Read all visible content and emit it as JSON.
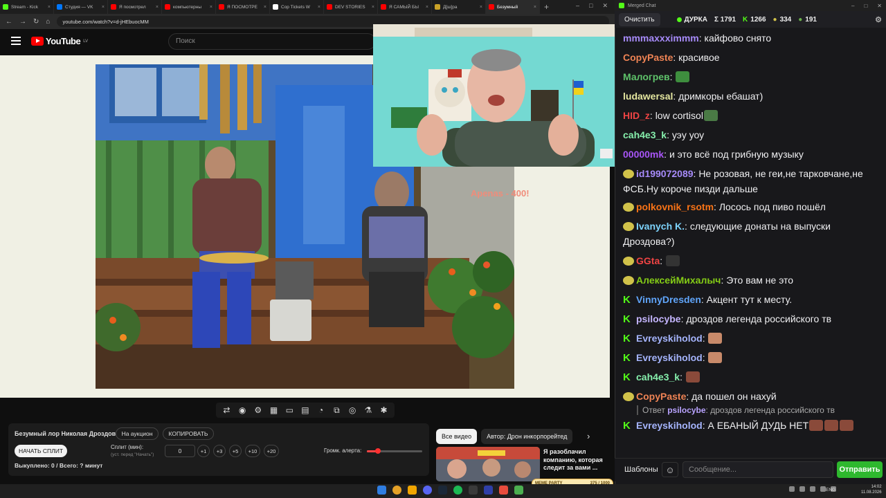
{
  "browser": {
    "tabs": [
      {
        "label": "Stream - Kick",
        "color": "#53fc18",
        "active": false
      },
      {
        "label": "Студия — VK",
        "color": "#0077ff",
        "active": false
      },
      {
        "label": "Я посмотрел",
        "color": "#ff0000",
        "active": false
      },
      {
        "label": "компьютерны",
        "color": "#ff0000",
        "active": false
      },
      {
        "label": "Я ПОСМОТРЕ",
        "color": "#ff0000",
        "active": false
      },
      {
        "label": "Cop Tickets W",
        "color": "#ffffff",
        "active": false
      },
      {
        "label": "DEV STORIES",
        "color": "#ff0000",
        "active": false
      },
      {
        "label": "Я САМЫЙ БЫ",
        "color": "#ff0000",
        "active": false
      },
      {
        "label": "Д[ш]ра",
        "color": "#c9a227",
        "active": false
      },
      {
        "label": "Безумный",
        "color": "#ff0000",
        "active": true
      }
    ],
    "new_tab": "+",
    "url": "youtube.com/watch?v=d-jHEbuocMM"
  },
  "youtube": {
    "logo_text": "YouTube",
    "region": "LV",
    "search_placeholder": "Поиск",
    "donation_alert": "Apenas - 400!",
    "split": {
      "title": "Безумный лор Николая Дроздова",
      "auction_btn": "На аукцион",
      "copy_btn": "КОПИРОВАТЬ",
      "start_btn": "НАЧАТЬ СПЛИТ",
      "split_label": "Сплит (мин):",
      "split_hint": "(уст. перед \"Начать\")",
      "split_value": "0",
      "increments": [
        "+1",
        "+3",
        "+5",
        "+10",
        "+20"
      ],
      "volume_label": "Громк. алерта:",
      "volume_level": 0.2,
      "bought": "Выкуплено: 0 / Всего: ? минут"
    },
    "chips": [
      "Все видео",
      "Автор: Дрон инкорпорейтед"
    ],
    "rec_title": "Я разоблачил компанию, которая следит за вами ...",
    "meme_party": "MEME PARTY",
    "meme_count": "375 / 1000"
  },
  "taskbar": {
    "lang": "ENG",
    "time": "14:02",
    "date": "11.08.2026"
  },
  "chat": {
    "window_title": "Merged Chat",
    "clear_btn": "Очистить",
    "channel": "ДУРКА",
    "stats": [
      "Σ 1791",
      "1266",
      "334",
      "191"
    ],
    "messages": [
      {
        "user": "mmmaxxximmm",
        "color": "#a78bfa",
        "text": "кайфово снято",
        "badge": "none"
      },
      {
        "user": "CopyPaste",
        "color": "#ef8354",
        "text": "красивое",
        "badge": "none"
      },
      {
        "user": "Малогрев",
        "color": "#5ec26a",
        "text": "",
        "badge": "none",
        "emote": "#3e8e3e"
      },
      {
        "user": "ludawersal",
        "color": "#e5e7a0",
        "text": "дримкоры ебашат)",
        "badge": "none"
      },
      {
        "user": "HID_z",
        "color": "#ef4444",
        "text": "low cortisol",
        "badge": "none",
        "emote": "#4a7a45"
      },
      {
        "user": "cah4e3_k",
        "color": "#86efac",
        "text": "уэу уоу",
        "badge": "none"
      },
      {
        "user": "00000mk",
        "color": "#a855f7",
        "text": "и это всё под грибную музыку",
        "badge": "none"
      },
      {
        "user": "id199072089",
        "color": "#a78bfa",
        "text": "Не розовая, не геи,не тарковчане,не ФСБ.Ну короче пизди дальше",
        "badge": "vk"
      },
      {
        "user": "polkovnik_rsotm",
        "color": "#f97316",
        "text": "Лосось под пиво пошёл",
        "badge": "vk"
      },
      {
        "user": "Ivanych K.",
        "color": "#7dd3fc",
        "text": "следующие донаты на выпуски Дроздова?)",
        "badge": "vk"
      },
      {
        "user": "GGta",
        "color": "#ef4444",
        "text": "",
        "badge": "vk",
        "emote": "#333333"
      },
      {
        "user": "АлексейМихалыч",
        "color": "#84cc16",
        "text": "Это вам не это",
        "badge": "vk"
      },
      {
        "user": "VinnyDresden",
        "color": "#60a5fa",
        "text": "Акцент тут к месту.",
        "badge": "kick"
      },
      {
        "user": "psilocybe",
        "color": "#c4b5fd",
        "text": "дроздов легенда российского тв",
        "badge": "kick"
      },
      {
        "user": "Evreyskiholod",
        "color": "#a5b4fc",
        "text": "",
        "badge": "kick",
        "emote": "#c88a6a"
      },
      {
        "user": "Evreyskiholod",
        "color": "#a5b4fc",
        "text": "",
        "badge": "kick",
        "emote": "#c88a6a"
      },
      {
        "user": "cah4e3_k",
        "color": "#86efac",
        "text": "",
        "badge": "kick",
        "emote": "#8a4a3a"
      },
      {
        "user": "CopyPaste",
        "color": "#ef8354",
        "text": "да пошел он нахуй",
        "badge": "vk"
      },
      {
        "user": "Evreyskiholod",
        "color": "#a5b4fc",
        "text": "А ЕБАНЫЙ ДУДЬ НЕТ",
        "badge": "kick",
        "emote": "#8a4a3a"
      }
    ],
    "reply": {
      "prefix": "Ответ",
      "user": "psilocybe",
      "text": "дроздов легенда российского тв"
    },
    "templates_btn": "Шаблоны",
    "input_placeholder": "Сообщение...",
    "send_btn": "Отправить"
  }
}
